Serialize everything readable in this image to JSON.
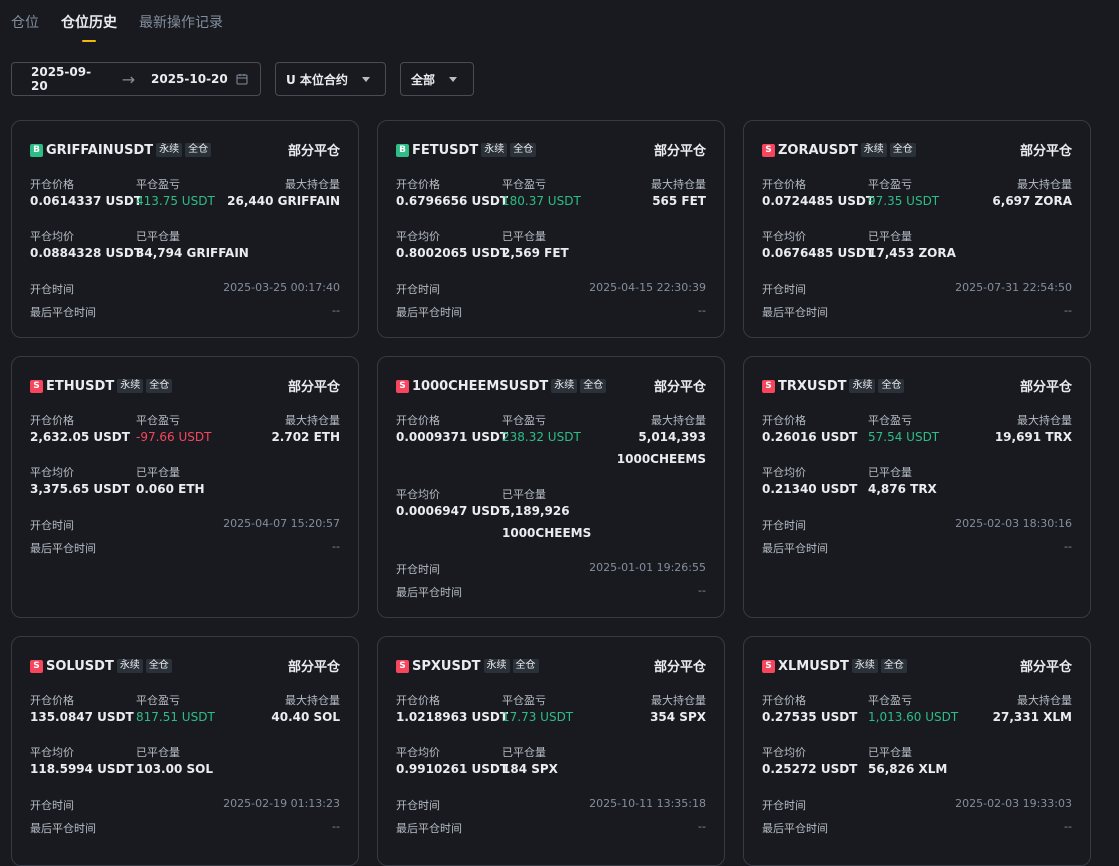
{
  "tabs": [
    "仓位",
    "仓位历史",
    "最新操作记录"
  ],
  "filters": {
    "date_start": "2025-09-20",
    "date_end": "2025-10-20",
    "contract_type": "U 本位合约",
    "scope": "全部"
  },
  "labels": {
    "open_price": "开仓价格",
    "pnl": "平仓盈亏",
    "max_position": "最大持仓量",
    "avg_close_price": "平仓均价",
    "closed_qty": "已平仓量",
    "open_time": "开仓时间",
    "last_close_time": "最后平仓时间"
  },
  "tag_perp": "永续",
  "tag_cross": "全仓",
  "colors": {
    "accent": "#f0b90b",
    "long": "#2ebd85",
    "short": "#f6465d",
    "bg": "#181a20",
    "border": "#363a45"
  },
  "positions": [
    {
      "side": "B",
      "symbol": "GRIFFAINUSDT",
      "status": "部分平仓",
      "open_price": "0.0614337 USDT",
      "pnl": "413.75 USDT",
      "pnl_sign": "positive",
      "max_position": "26,440 GRIFFAIN",
      "max_position_extra": "",
      "avg_close_price": "0.0884328 USDT",
      "closed_qty": "34,794 GRIFFAIN",
      "closed_qty_extra": "",
      "open_time": "2025-03-25 00:17:40",
      "last_close_time": "--"
    },
    {
      "side": "B",
      "symbol": "FETUSDT",
      "status": "部分平仓",
      "open_price": "0.6796656 USDT",
      "pnl": "180.37 USDT",
      "pnl_sign": "positive",
      "max_position": "565 FET",
      "max_position_extra": "",
      "avg_close_price": "0.8002065 USDT",
      "closed_qty": "2,569 FET",
      "closed_qty_extra": "",
      "open_time": "2025-04-15 22:30:39",
      "last_close_time": "--"
    },
    {
      "side": "S",
      "symbol": "ZORAUSDT",
      "status": "部分平仓",
      "open_price": "0.0724485 USDT",
      "pnl": "97.35 USDT",
      "pnl_sign": "positive",
      "max_position": "6,697 ZORA",
      "max_position_extra": "",
      "avg_close_price": "0.0676485 USDT",
      "closed_qty": "17,453 ZORA",
      "closed_qty_extra": "",
      "open_time": "2025-07-31 22:54:50",
      "last_close_time": "--"
    },
    {
      "side": "S",
      "symbol": "ETHUSDT",
      "status": "部分平仓",
      "open_price": "2,632.05 USDT",
      "pnl": "-97.66 USDT",
      "pnl_sign": "negative",
      "max_position": "2.702 ETH",
      "max_position_extra": "",
      "avg_close_price": "3,375.65 USDT",
      "closed_qty": "0.060 ETH",
      "closed_qty_extra": "",
      "open_time": "2025-04-07 15:20:57",
      "last_close_time": "--"
    },
    {
      "side": "S",
      "symbol": "1000CHEEMSUSDT",
      "status": "部分平仓",
      "open_price": "0.0009371 USDT",
      "pnl": "238.32 USDT",
      "pnl_sign": "positive",
      "max_position": "5,014,393",
      "max_position_extra": "1000CHEEMS",
      "avg_close_price": "0.0006947 USDT",
      "closed_qty": "5,189,926",
      "closed_qty_extra": "1000CHEEMS",
      "open_time": "2025-01-01 19:26:55",
      "last_close_time": "--"
    },
    {
      "side": "S",
      "symbol": "TRXUSDT",
      "status": "部分平仓",
      "open_price": "0.26016 USDT",
      "pnl": "57.54 USDT",
      "pnl_sign": "positive",
      "max_position": "19,691 TRX",
      "max_position_extra": "",
      "avg_close_price": "0.21340 USDT",
      "closed_qty": "4,876 TRX",
      "closed_qty_extra": "",
      "open_time": "2025-02-03 18:30:16",
      "last_close_time": "--"
    },
    {
      "side": "S",
      "symbol": "SOLUSDT",
      "status": "部分平仓",
      "open_price": "135.0847 USDT",
      "pnl": "817.51 USDT",
      "pnl_sign": "positive",
      "max_position": "40.40 SOL",
      "max_position_extra": "",
      "avg_close_price": "118.5994 USDT",
      "closed_qty": "103.00 SOL",
      "closed_qty_extra": "",
      "open_time": "2025-02-19 01:13:23",
      "last_close_time": "--"
    },
    {
      "side": "S",
      "symbol": "SPXUSDT",
      "status": "部分平仓",
      "open_price": "1.0218963 USDT",
      "pnl": "17.73 USDT",
      "pnl_sign": "positive",
      "max_position": "354 SPX",
      "max_position_extra": "",
      "avg_close_price": "0.9910261 USDT",
      "closed_qty": "184 SPX",
      "closed_qty_extra": "",
      "open_time": "2025-10-11 13:35:18",
      "last_close_time": "--"
    },
    {
      "side": "S",
      "symbol": "XLMUSDT",
      "status": "部分平仓",
      "open_price": "0.27535 USDT",
      "pnl": "1,013.60 USDT",
      "pnl_sign": "positive",
      "max_position": "27,331 XLM",
      "max_position_extra": "",
      "avg_close_price": "0.25272 USDT",
      "closed_qty": "56,826 XLM",
      "closed_qty_extra": "",
      "open_time": "2025-02-03 19:33:03",
      "last_close_time": "--"
    }
  ]
}
